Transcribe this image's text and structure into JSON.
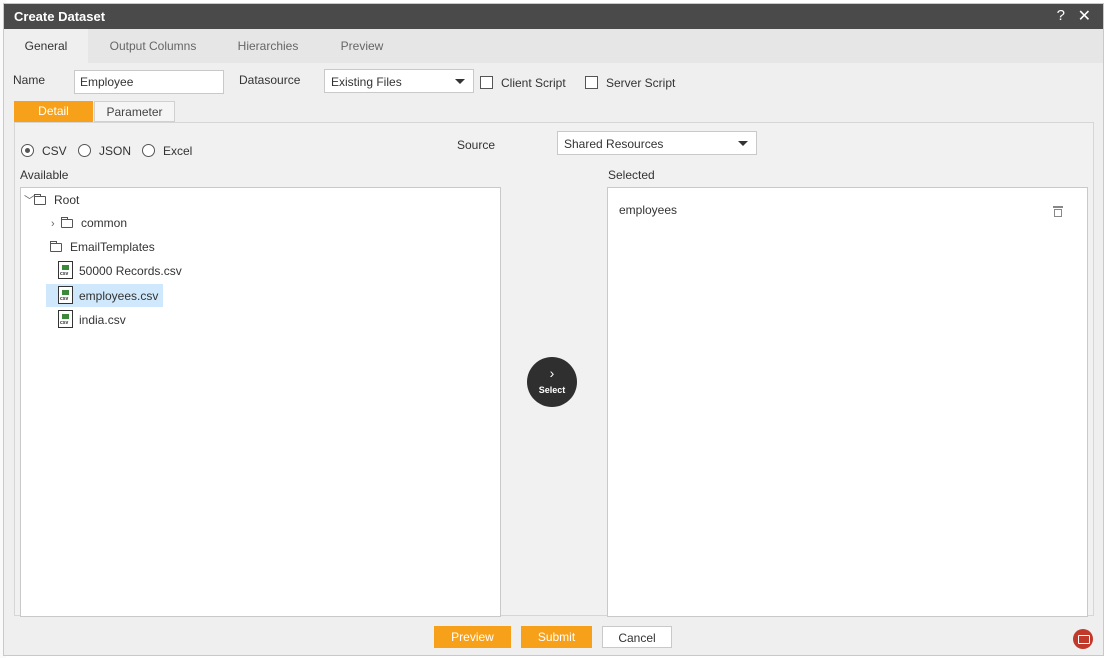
{
  "dialog": {
    "title": "Create Dataset",
    "help": "?",
    "close": "✕"
  },
  "tabs": [
    "General",
    "Output Columns",
    "Hierarchies",
    "Preview"
  ],
  "form": {
    "name_label": "Name",
    "name_value": "Employee",
    "datasource_label": "Datasource",
    "datasource_value": "Existing Files",
    "client_script": "Client Script",
    "server_script": "Server Script"
  },
  "subtabs": [
    "Detail",
    "Parameter"
  ],
  "detail": {
    "formats": [
      "CSV",
      "JSON",
      "Excel"
    ],
    "selected_format": "CSV",
    "source_label": "Source",
    "source_value": "Shared Resources",
    "available_label": "Available",
    "selected_label": "Selected"
  },
  "tree": {
    "root": "Root",
    "common": "common",
    "email_templates": "EmailTemplates",
    "files": [
      "50000 Records.csv",
      "employees.csv",
      "india.csv"
    ],
    "highlighted": "employees.csv"
  },
  "select_button": {
    "arrow": "›",
    "label": "Select"
  },
  "selected_items": [
    "employees"
  ],
  "footer": {
    "preview": "Preview",
    "submit": "Submit",
    "cancel": "Cancel"
  },
  "colors": {
    "accent": "#f7a11a",
    "titlebar": "#4a4a4a",
    "selection": "#cfe8fb",
    "chat": "#c0392b"
  }
}
